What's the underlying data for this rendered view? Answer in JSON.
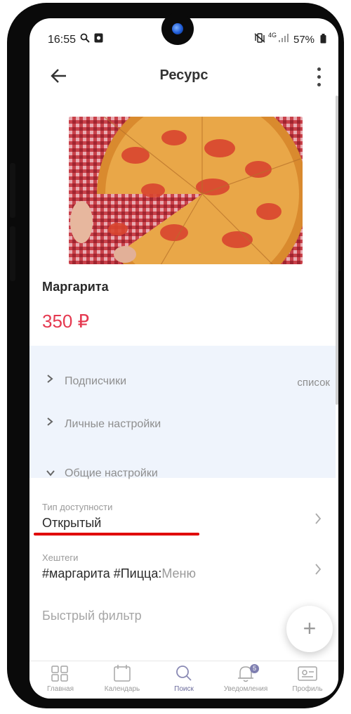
{
  "status_bar": {
    "time": "16:55",
    "left_icons": [
      "search-icon",
      "camera-square-icon"
    ],
    "right_icons": [
      "mute-vibrate-icon",
      "4g-icon",
      "signal-icon"
    ],
    "network": "4G",
    "battery": "57%"
  },
  "header": {
    "title": "Ресурс",
    "back_icon": "arrow-left-icon",
    "menu_icon": "more-vertical-icon"
  },
  "product": {
    "image": "pizza-photo",
    "name": "Маргарита",
    "price": "350 ₽"
  },
  "accordion": {
    "items": [
      {
        "label": "Подписчики",
        "right": "список",
        "state": "collapsed"
      },
      {
        "label": "Личные настройки",
        "right": "",
        "state": "collapsed"
      },
      {
        "label": "Общие настройки",
        "right": "",
        "state": "expanded"
      }
    ]
  },
  "fields": {
    "availability": {
      "caption": "Тип доступности",
      "value": "Открытый"
    },
    "hashtags": {
      "caption": "Хештеги",
      "value": "#маргарита #Пицца:",
      "muted": "Меню"
    },
    "quick_filter": {
      "label": "Быстрый фильтр"
    }
  },
  "fab": {
    "label": "+"
  },
  "bottom_nav": {
    "items": [
      {
        "label": "Главная",
        "icon": "grid-icon"
      },
      {
        "label": "Календарь",
        "icon": "calendar-icon"
      },
      {
        "label": "Поиск",
        "icon": "search-icon",
        "active": true
      },
      {
        "label": "Уведомления",
        "icon": "bell-icon",
        "badge": "5"
      },
      {
        "label": "Профиль",
        "icon": "id-card-icon"
      }
    ]
  },
  "colors": {
    "price": "#e53950",
    "accordion_bg": "#eff4fc",
    "underline": "#e00000",
    "nav_active": "#6c6c9c"
  }
}
